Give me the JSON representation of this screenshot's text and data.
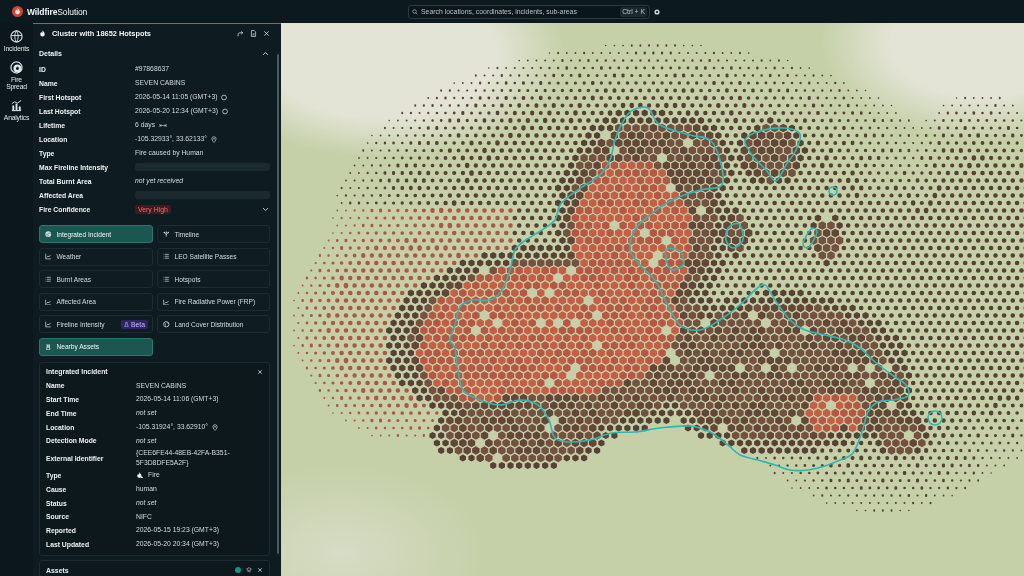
{
  "brand": {
    "name_bold": "Wildfire",
    "name_rest": "Solution"
  },
  "search": {
    "placeholder": "Search locations, coordinates, incidents, sub-areas",
    "shortcut": "Ctrl + K"
  },
  "nav": [
    {
      "label": "Incidents",
      "kind": "incidents"
    },
    {
      "label": "Fire Spread",
      "kind": "spread"
    },
    {
      "label": "Analytics",
      "kind": "analytics"
    }
  ],
  "panel": {
    "title": "Cluster with 18652 Hotspots",
    "details": {
      "title": "Details",
      "expanded": true,
      "rows": [
        {
          "label": "ID",
          "value": "#97868637",
          "kind": "text"
        },
        {
          "label": "Name",
          "value": "SEVEN CABINS",
          "kind": "text"
        },
        {
          "label": "First Hotspot",
          "value": "2026-05-14 11:05 (GMT+3)",
          "kind": "time"
        },
        {
          "label": "Last Hotspot",
          "value": "2026-05-20 12:34 (GMT+3)",
          "kind": "time"
        },
        {
          "label": "Lifetime",
          "value": "6 days",
          "kind": "duration"
        },
        {
          "label": "Location",
          "value": "-105.32933°, 33.62133°",
          "kind": "location"
        },
        {
          "label": "Type",
          "value": "Fire caused by Human",
          "kind": "text"
        },
        {
          "label": "Max Fireline Intensity",
          "kind": "loading"
        },
        {
          "label": "Total Burnt Area",
          "value": "not yet received",
          "kind": "pending"
        },
        {
          "label": "Affected Area",
          "kind": "loading"
        },
        {
          "label": "Fire Confidence",
          "value": "Very High",
          "kind": "badge",
          "expanded": false
        }
      ]
    },
    "buttons": [
      {
        "label": "Integrated Incident",
        "kind": "incident",
        "selected": true
      },
      {
        "label": "Timeline",
        "kind": "timeline",
        "selected": false
      },
      {
        "label": "Weather",
        "kind": "chart",
        "selected": false
      },
      {
        "label": "LEO Satellite Passes",
        "kind": "list",
        "selected": false
      },
      {
        "label": "Burnt Areas",
        "kind": "list",
        "selected": false
      },
      {
        "label": "Hotspots",
        "kind": "list",
        "selected": false
      },
      {
        "label": "Affected Area",
        "kind": "chart",
        "selected": false
      },
      {
        "label": "Fire Radiative Power (FRP)",
        "kind": "chart",
        "selected": false
      },
      {
        "label": "Fireline Intensity",
        "kind": "chart",
        "selected": false,
        "badge": "Beta"
      },
      {
        "label": "Land Cover Distribution",
        "kind": "globe",
        "selected": false
      },
      {
        "label": "Nearby Assets",
        "kind": "assets",
        "selected": true
      }
    ],
    "incident": {
      "title": "Integrated Incident",
      "rows": [
        {
          "label": "Name",
          "value": "SEVEN CABINS",
          "kind": "text"
        },
        {
          "label": "Start Time",
          "value": "2026-05-14 11:06 (GMT+3)",
          "kind": "text"
        },
        {
          "label": "End Time",
          "value": "not set",
          "kind": "pending"
        },
        {
          "label": "Location",
          "value": "-105.31924°, 33.62910°",
          "kind": "location"
        },
        {
          "label": "Detection Mode",
          "value": "not set",
          "kind": "pending"
        },
        {
          "label": "External Identifier",
          "value": "{CEE6FE44-48EB-42FA-B351-5F3D8DFE5A2F}",
          "kind": "text"
        },
        {
          "label": "Type",
          "value": "Fire",
          "kind": "fire"
        },
        {
          "label": "Cause",
          "value": "human",
          "kind": "text"
        },
        {
          "label": "Status",
          "value": "not set",
          "kind": "pending"
        },
        {
          "label": "Source",
          "value": "NIFC",
          "kind": "text"
        },
        {
          "label": "Reported",
          "value": "2026-05-15 19:23 (GMT+3)",
          "kind": "text"
        },
        {
          "label": "Last Updated",
          "value": "2026-05-20 20:34 (GMT+3)",
          "kind": "text"
        }
      ]
    },
    "assets": {
      "title": "Assets"
    }
  }
}
